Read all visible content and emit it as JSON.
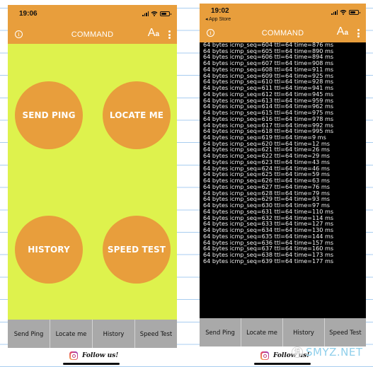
{
  "colors": {
    "header": "#e89e3c",
    "main_background": "#def24d",
    "circle_button": "#e89e3c",
    "terminal_background": "#000000",
    "tabbar": "#a9a9a9"
  },
  "left_screen": {
    "status_bar": {
      "time": "19:06"
    },
    "nav": {
      "title": "COMMAND",
      "info_icon": "i",
      "font_icon": "A",
      "font_icon_small": "a"
    },
    "circle_buttons": [
      {
        "label": "SEND PING"
      },
      {
        "label": "LOCATE ME"
      },
      {
        "label": "HISTORY"
      },
      {
        "label": "SPEED TEST"
      }
    ],
    "tabs": [
      {
        "label": "Send Ping"
      },
      {
        "label": "Locate me"
      },
      {
        "label": "History"
      },
      {
        "label": "Speed Test"
      }
    ],
    "footer": {
      "follow_text": "Follow us!",
      "icon": "instagram-icon"
    }
  },
  "right_screen": {
    "status_bar": {
      "time": "19:02",
      "back_link": "◂ App Store"
    },
    "nav": {
      "title": "COMMAND",
      "info_icon": "i",
      "font_icon": "A",
      "font_icon_small": "a"
    },
    "ping_output": [
      "64 bytes icmp_seq=604 ttl=64 time=876 ms",
      "64 bytes icmp_seq=605 ttl=64 time=890 ms",
      "64 bytes icmp_seq=606 ttl=64 time=894 ms",
      "64 bytes icmp_seq=607 ttl=64 time=908 ms",
      "64 bytes icmp_seq=608 ttl=64 time=911 ms",
      "64 bytes icmp_seq=609 ttl=64 time=925 ms",
      "64 bytes icmp_seq=610 ttl=64 time=928 ms",
      "64 bytes icmp_seq=611 ttl=64 time=941 ms",
      "64 bytes icmp_seq=612 ttl=64 time=945 ms",
      "64 bytes icmp_seq=613 ttl=64 time=959 ms",
      "64 bytes icmp_seq=614 ttl=64 time=962 ms",
      "64 bytes icmp_seq=615 ttl=64 time=975 ms",
      "64 bytes icmp_seq=616 ttl=64 time=978 ms",
      "64 bytes icmp_seq=617 ttl=64 time=992 ms",
      "64 bytes icmp_seq=618 ttl=64 time=995 ms",
      "64 bytes icmp_seq=619 ttl=64 time=9 ms",
      "64 bytes icmp_seq=620 ttl=64 time=12 ms",
      "64 bytes icmp_seq=621 ttl=64 time=26 ms",
      "64 bytes icmp_seq=622 ttl=64 time=29 ms",
      "64 bytes icmp_seq=623 ttl=64 time=43 ms",
      "64 bytes icmp_seq=624 ttl=64 time=46 ms",
      "64 bytes icmp_seq=625 ttl=64 time=59 ms",
      "64 bytes icmp_seq=626 ttl=64 time=63 ms",
      "64 bytes icmp_seq=627 ttl=64 time=76 ms",
      "64 bytes icmp_seq=628 ttl=64 time=79 ms",
      "64 bytes icmp_seq=629 ttl=64 time=93 ms",
      "64 bytes icmp_seq=630 ttl=64 time=97 ms",
      "64 bytes icmp_seq=631 ttl=64 time=110 ms",
      "64 bytes icmp_seq=632 ttl=64 time=114 ms",
      "64 bytes icmp_seq=633 ttl=64 time=127 ms",
      "64 bytes icmp_seq=634 ttl=64 time=130 ms",
      "64 bytes icmp_seq=635 ttl=64 time=144 ms",
      "64 bytes icmp_seq=636 ttl=64 time=157 ms",
      "64 bytes icmp_seq=637 ttl=64 time=160 ms",
      "64 bytes icmp_seq=638 ttl=64 time=173 ms",
      "64 bytes icmp_seq=639 ttl=64 time=177 ms"
    ],
    "tabs": [
      {
        "label": "Send Ping"
      },
      {
        "label": "Locate me"
      },
      {
        "label": "History"
      },
      {
        "label": "Speed Test"
      }
    ],
    "footer": {
      "follow_text": "Follow us!",
      "icon": "instagram-icon"
    }
  },
  "watermark": {
    "badge": "值",
    "text": "SMYZ.NET"
  }
}
